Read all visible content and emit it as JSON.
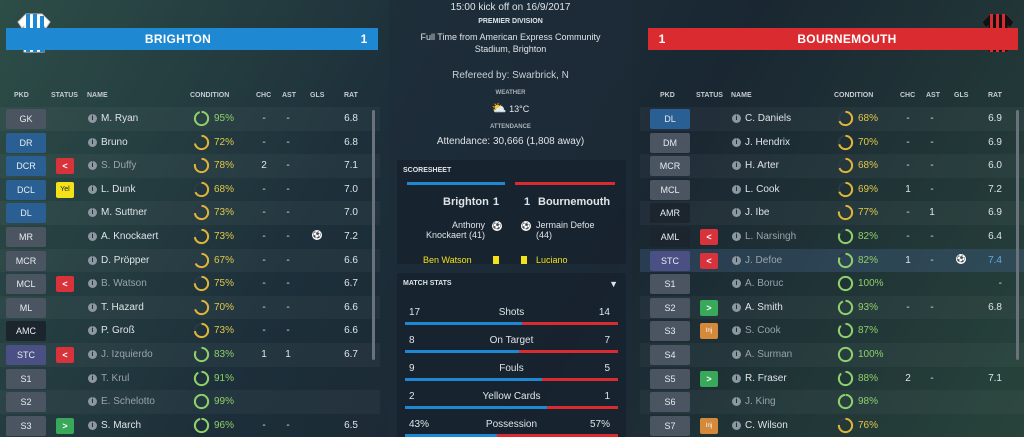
{
  "home": {
    "name": "BRIGHTON",
    "score": "1",
    "color": "#1e88d2",
    "players": [
      {
        "pos": "GK",
        "pos_style": "grey",
        "status": "",
        "name": "M. Ryan",
        "cond": "95%",
        "pct": 95,
        "chc": "-",
        "ast": "-",
        "gls": "",
        "rat": "6.8",
        "dim": false
      },
      {
        "pos": "DR",
        "pos_style": "blue",
        "status": "",
        "name": "Bruno",
        "cond": "72%",
        "pct": 72,
        "chc": "-",
        "ast": "-",
        "gls": "",
        "rat": "6.8",
        "dim": false
      },
      {
        "pos": "DCR",
        "pos_style": "blue",
        "status": "sub-off",
        "name": "S. Duffy",
        "cond": "78%",
        "pct": 78,
        "chc": "2",
        "ast": "-",
        "gls": "",
        "rat": "7.1",
        "dim": true
      },
      {
        "pos": "DCL",
        "pos_style": "blue",
        "status": "yellow",
        "name": "L. Dunk",
        "cond": "68%",
        "pct": 68,
        "chc": "-",
        "ast": "-",
        "gls": "",
        "rat": "7.0",
        "dim": false
      },
      {
        "pos": "DL",
        "pos_style": "blue",
        "status": "",
        "name": "M. Suttner",
        "cond": "73%",
        "pct": 73,
        "chc": "-",
        "ast": "-",
        "gls": "",
        "rat": "7.0",
        "dim": false
      },
      {
        "pos": "MR",
        "pos_style": "grey",
        "status": "",
        "name": "A. Knockaert",
        "cond": "73%",
        "pct": 73,
        "chc": "-",
        "ast": "-",
        "gls": "goal",
        "rat": "7.2",
        "dim": false
      },
      {
        "pos": "MCR",
        "pos_style": "grey",
        "status": "",
        "name": "D. Pröpper",
        "cond": "67%",
        "pct": 67,
        "chc": "-",
        "ast": "-",
        "gls": "",
        "rat": "6.6",
        "dim": false
      },
      {
        "pos": "MCL",
        "pos_style": "grey",
        "status": "sub-off",
        "name": "B. Watson",
        "cond": "75%",
        "pct": 75,
        "chc": "-",
        "ast": "-",
        "gls": "",
        "rat": "6.7",
        "dim": true
      },
      {
        "pos": "ML",
        "pos_style": "grey",
        "status": "",
        "name": "T. Hazard",
        "cond": "70%",
        "pct": 70,
        "chc": "-",
        "ast": "-",
        "gls": "",
        "rat": "6.6",
        "dim": false
      },
      {
        "pos": "AMC",
        "pos_style": "dark",
        "status": "",
        "name": "P. Groß",
        "cond": "73%",
        "pct": 73,
        "chc": "-",
        "ast": "-",
        "gls": "",
        "rat": "6.6",
        "dim": false
      },
      {
        "pos": "STC",
        "pos_style": "purple",
        "status": "sub-off",
        "name": "J. Izquierdo",
        "cond": "83%",
        "pct": 83,
        "chc": "1",
        "ast": "1",
        "gls": "",
        "rat": "6.7",
        "dim": true
      },
      {
        "pos": "S1",
        "pos_style": "grey",
        "status": "",
        "name": "T. Krul",
        "cond": "91%",
        "pct": 91,
        "chc": "",
        "ast": "",
        "gls": "",
        "rat": "",
        "dim": true
      },
      {
        "pos": "S2",
        "pos_style": "grey",
        "status": "",
        "name": "E. Schelotto",
        "cond": "99%",
        "pct": 99,
        "chc": "",
        "ast": "",
        "gls": "",
        "rat": "",
        "dim": true
      },
      {
        "pos": "S3",
        "pos_style": "grey",
        "status": "sub-on",
        "name": "S. March",
        "cond": "96%",
        "pct": 96,
        "chc": "-",
        "ast": "-",
        "gls": "",
        "rat": "6.5",
        "dim": false
      }
    ]
  },
  "away": {
    "name": "BOURNEMOUTH",
    "score": "1",
    "color": "#d92b30",
    "players": [
      {
        "pos": "DL",
        "pos_style": "blue",
        "status": "",
        "name": "C. Daniels",
        "cond": "68%",
        "pct": 68,
        "chc": "-",
        "ast": "-",
        "gls": "",
        "rat": "6.9",
        "dim": false
      },
      {
        "pos": "DM",
        "pos_style": "grey",
        "status": "",
        "name": "J. Hendrix",
        "cond": "70%",
        "pct": 70,
        "chc": "-",
        "ast": "-",
        "gls": "",
        "rat": "6.9",
        "dim": false
      },
      {
        "pos": "MCR",
        "pos_style": "grey",
        "status": "",
        "name": "H. Arter",
        "cond": "68%",
        "pct": 68,
        "chc": "-",
        "ast": "-",
        "gls": "",
        "rat": "6.0",
        "dim": false
      },
      {
        "pos": "MCL",
        "pos_style": "grey",
        "status": "",
        "name": "L. Cook",
        "cond": "69%",
        "pct": 69,
        "chc": "1",
        "ast": "-",
        "gls": "",
        "rat": "7.2",
        "dim": false
      },
      {
        "pos": "AMR",
        "pos_style": "dark",
        "status": "",
        "name": "J. Ibe",
        "cond": "77%",
        "pct": 77,
        "chc": "-",
        "ast": "1",
        "gls": "",
        "rat": "6.9",
        "dim": false
      },
      {
        "pos": "AML",
        "pos_style": "dark",
        "status": "sub-off",
        "name": "L. Narsingh",
        "cond": "82%",
        "pct": 82,
        "chc": "-",
        "ast": "-",
        "gls": "",
        "rat": "6.4",
        "dim": true
      },
      {
        "pos": "STC",
        "pos_style": "purple",
        "status": "sub-off",
        "name": "J. Defoe",
        "cond": "82%",
        "pct": 82,
        "chc": "1",
        "ast": "-",
        "gls": "goal",
        "rat": "7.4",
        "dim": true
      },
      {
        "pos": "S1",
        "pos_style": "grey",
        "status": "",
        "name": "A. Boruc",
        "cond": "100%",
        "pct": 100,
        "chc": "",
        "ast": "",
        "gls": "",
        "rat": "-",
        "dim": true
      },
      {
        "pos": "S2",
        "pos_style": "grey",
        "status": "sub-on",
        "name": "A. Smith",
        "cond": "93%",
        "pct": 93,
        "chc": "-",
        "ast": "-",
        "gls": "",
        "rat": "6.8",
        "dim": false
      },
      {
        "pos": "S3",
        "pos_style": "grey",
        "status": "injury",
        "name": "S. Cook",
        "cond": "87%",
        "pct": 87,
        "chc": "",
        "ast": "",
        "gls": "",
        "rat": "",
        "dim": true
      },
      {
        "pos": "S4",
        "pos_style": "grey",
        "status": "",
        "name": "A. Surman",
        "cond": "100%",
        "pct": 100,
        "chc": "",
        "ast": "",
        "gls": "",
        "rat": "",
        "dim": true
      },
      {
        "pos": "S5",
        "pos_style": "grey",
        "status": "sub-on",
        "name": "R. Fraser",
        "cond": "88%",
        "pct": 88,
        "chc": "2",
        "ast": "-",
        "gls": "",
        "rat": "7.1",
        "dim": false
      },
      {
        "pos": "S6",
        "pos_style": "grey",
        "status": "",
        "name": "J. King",
        "cond": "98%",
        "pct": 98,
        "chc": "",
        "ast": "",
        "gls": "",
        "rat": "",
        "dim": true
      },
      {
        "pos": "S7",
        "pos_style": "grey",
        "status": "injury",
        "name": "C. Wilson",
        "cond": "76%",
        "pct": 76,
        "chc": "",
        "ast": "",
        "gls": "",
        "rat": "",
        "dim": false
      }
    ]
  },
  "headers": {
    "pkd": "PKD",
    "status": "STATUS",
    "name": "NAME",
    "condition": "CONDITION",
    "chc": "CHC",
    "ast": "AST",
    "gls": "GLS",
    "rat": "RAT"
  },
  "status_labels": {
    "sub-off": "<",
    "sub-on": ">",
    "yellow": "Yel",
    "injury": "Inj"
  },
  "match": {
    "kickoff": "15:00 kick off on 16/9/2017",
    "division": "PREMIER DIVISION",
    "result_line1": "Full Time from American Express Community",
    "result_line2": "Stadium, Brighton",
    "referee": "Refereed by: Swarbrick, N",
    "weather_label": "WEATHER",
    "weather_icon": "partly-cloudy-icon",
    "temperature": "13°C",
    "attendance_label": "ATTENDANCE",
    "attendance": "Attendance: 30,666 (1,808 away)"
  },
  "scoresheet": {
    "title": "SCORESHEET",
    "home_team": "Brighton",
    "home_score": "1",
    "away_score": "1",
    "away_team": "Bournemouth",
    "home_scorer_1": "Anthony",
    "home_scorer_2": "Knockaert (41)",
    "away_scorer_1": "Jermain Defoe",
    "away_scorer_2": "(44)",
    "home_card": "Ben Watson",
    "away_card": "Luciano"
  },
  "match_stats": {
    "title": "MATCH STATS",
    "rows": [
      {
        "label": "Shots",
        "home": "17",
        "away": "14",
        "home_share": 0.548
      },
      {
        "label": "On Target",
        "home": "8",
        "away": "7",
        "home_share": 0.533
      },
      {
        "label": "Fouls",
        "home": "9",
        "away": "5",
        "home_share": 0.643
      },
      {
        "label": "Yellow Cards",
        "home": "2",
        "away": "1",
        "home_share": 0.667
      },
      {
        "label": "Possession",
        "home": "43%",
        "away": "57%",
        "home_share": 0.43
      }
    ]
  }
}
